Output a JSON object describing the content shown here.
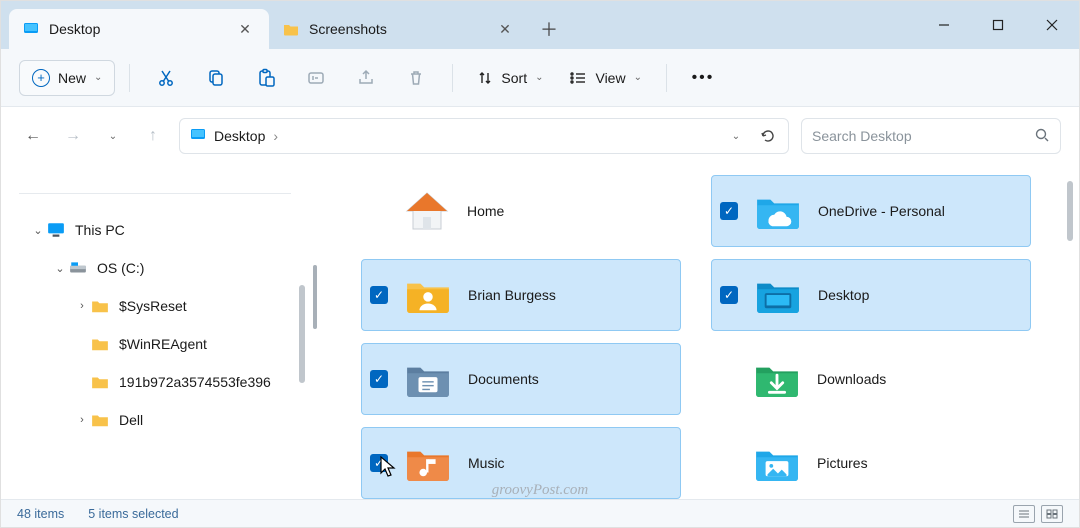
{
  "tabs": [
    {
      "label": "Desktop",
      "active": true
    },
    {
      "label": "Screenshots",
      "active": false
    }
  ],
  "toolbar": {
    "new_label": "New",
    "sort_label": "Sort",
    "view_label": "View"
  },
  "address": {
    "location": "Desktop",
    "search_placeholder": "Search Desktop"
  },
  "tree": {
    "root": "This PC",
    "drive": "OS (C:)",
    "children": [
      "$SysReset",
      "$WinREAgent",
      "191b972a3574553fe396",
      "Dell"
    ]
  },
  "files": {
    "col1": [
      {
        "label": "Home",
        "selected": false,
        "icon": "home"
      },
      {
        "label": "Brian Burgess",
        "selected": true,
        "icon": "user-folder"
      },
      {
        "label": "Documents",
        "selected": true,
        "icon": "documents"
      },
      {
        "label": "Music",
        "selected": true,
        "icon": "music"
      }
    ],
    "col2": [
      {
        "label": "OneDrive - Personal",
        "selected": true,
        "icon": "onedrive"
      },
      {
        "label": "Desktop",
        "selected": true,
        "icon": "desktop"
      },
      {
        "label": "Downloads",
        "selected": false,
        "icon": "downloads"
      },
      {
        "label": "Pictures",
        "selected": false,
        "icon": "pictures"
      }
    ]
  },
  "status": {
    "items_count": "48 items",
    "selected_count": "5 items selected"
  },
  "watermark": "groovyPost.com"
}
